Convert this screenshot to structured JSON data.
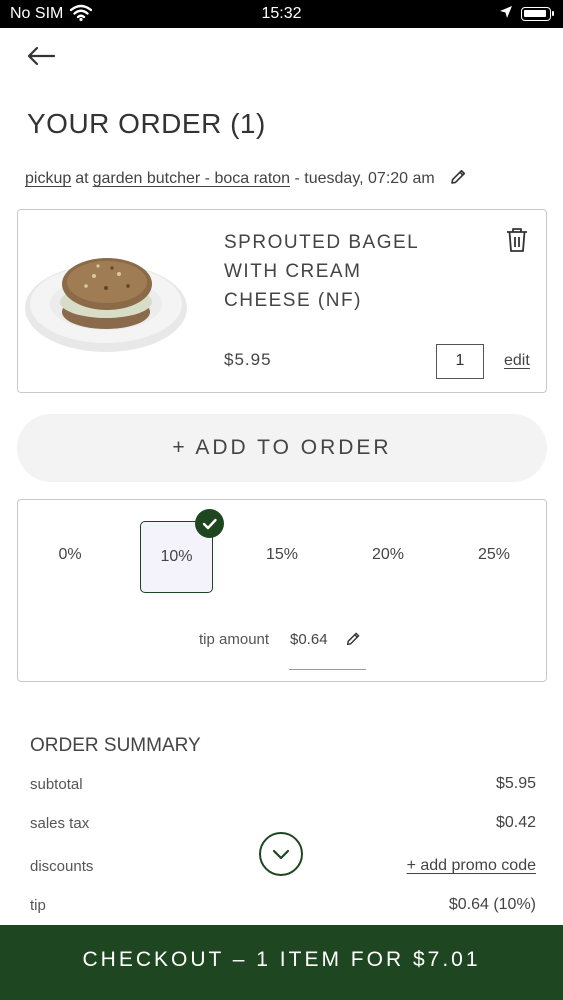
{
  "status_bar": {
    "carrier": "No SIM",
    "time": "15:32"
  },
  "header": {
    "title": "YOUR ORDER (1)"
  },
  "pickup": {
    "mode": "pickup",
    "at": "at",
    "location": "garden butcher - boca raton",
    "time": "- tuesday, 07:20 am"
  },
  "item": {
    "name": "SPROUTED BAGEL WITH CREAM CHEESE (NF)",
    "price": "$5.95",
    "quantity": "1",
    "edit_label": "edit"
  },
  "add_to_order_label": "+ ADD TO ORDER",
  "tip": {
    "options": [
      "0%",
      "10%",
      "15%",
      "20%",
      "25%"
    ],
    "selected": "10%",
    "amount_label": "tip amount",
    "amount_value": "$0.64"
  },
  "summary": {
    "title": "ORDER SUMMARY",
    "rows": [
      {
        "label": "subtotal",
        "value": "$5.95"
      },
      {
        "label": "sales tax",
        "value": "$0.42"
      },
      {
        "label": "discounts",
        "value": "+ add promo code"
      },
      {
        "label": "tip",
        "value": "$0.64 (10%)"
      }
    ]
  },
  "checkout_label": "CHECKOUT – 1 ITEM FOR $7.01",
  "colors": {
    "brand_green": "#1e4620",
    "selected_bg": "#f4f3fc",
    "button_bg": "#f3f3f3"
  }
}
